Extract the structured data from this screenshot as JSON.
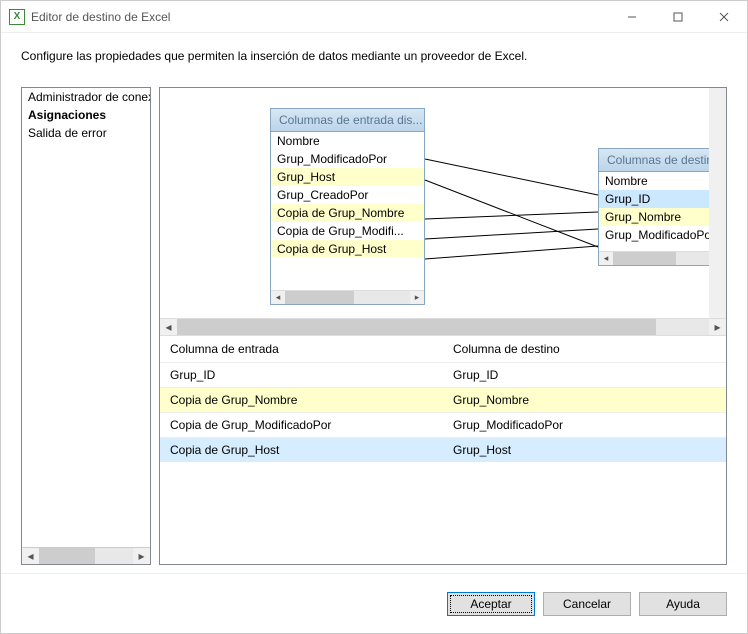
{
  "window": {
    "title": "Editor de destino de Excel"
  },
  "header": {
    "description": "Configure las propiedades que permiten la inserción de datos mediante un proveedor de Excel."
  },
  "sidebar": {
    "items": [
      {
        "label": "Administrador de conexiones"
      },
      {
        "label": "Asignaciones"
      },
      {
        "label": "Salida de error"
      }
    ],
    "selected_index": 1
  },
  "mapping": {
    "source": {
      "title": "Columnas de entrada dis...",
      "items": [
        {
          "label": "Nombre",
          "highlight": false
        },
        {
          "label": "Grup_ModificadoPor",
          "highlight": false
        },
        {
          "label": "Grup_Host",
          "highlight": true
        },
        {
          "label": "Grup_CreadoPor",
          "highlight": false
        },
        {
          "label": "Copia de Grup_Nombre",
          "highlight": true
        },
        {
          "label": "Copia de Grup_Modifi...",
          "highlight": false
        },
        {
          "label": "Copia de Grup_Host",
          "highlight": true
        }
      ]
    },
    "destination": {
      "title": "Columnas de destino d...",
      "items": [
        {
          "label": "Nombre",
          "highlight": false
        },
        {
          "label": "Grup_ID",
          "highlight": false,
          "selected": true
        },
        {
          "label": "Grup_Nombre",
          "highlight": true
        },
        {
          "label": "Grup_ModificadoPor",
          "highlight": false
        }
      ]
    }
  },
  "grid": {
    "columns": [
      "Columna de entrada",
      "Columna de destino"
    ],
    "rows": [
      {
        "input": "Grup_ID",
        "output": "Grup_ID",
        "highlight": false
      },
      {
        "input": "Copia de Grup_Nombre",
        "output": "Grup_Nombre",
        "highlight": true
      },
      {
        "input": "Copia de Grup_ModificadoPor",
        "output": "Grup_ModificadoPor",
        "highlight": false
      },
      {
        "input": "Copia de Grup_Host",
        "output": "Grup_Host",
        "highlight": false,
        "selected": true
      }
    ]
  },
  "buttons": {
    "ok": "Aceptar",
    "cancel": "Cancelar",
    "help": "Ayuda"
  }
}
